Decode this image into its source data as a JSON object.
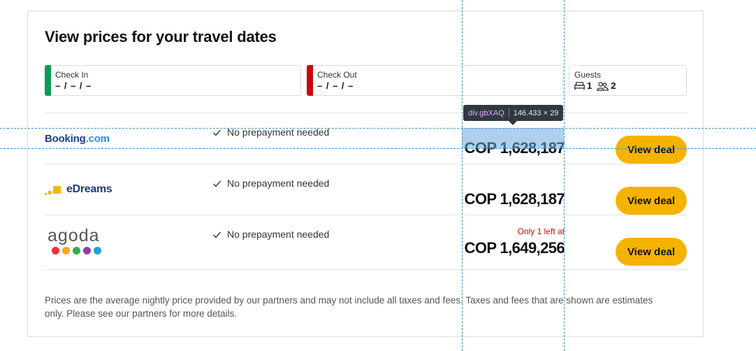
{
  "page": {
    "title": "View prices for your travel dates"
  },
  "dates": {
    "check_in": {
      "label": "Check In",
      "value": "– / – / –"
    },
    "check_out": {
      "label": "Check Out",
      "value": "– / – / –"
    },
    "guests": {
      "label": "Guests",
      "rooms": "1",
      "people": "2",
      "room_icon": "bed-icon",
      "people_icon": "people-icon"
    }
  },
  "offers": [
    {
      "provider": "Booking.com",
      "logo_main": "Booking",
      "logo_suffix": ".com",
      "feature": "No prepayment needed",
      "price": "COP 1,628,187",
      "scarcity": "",
      "button": "View deal"
    },
    {
      "provider": "eDreams",
      "logo_main": "eDreams",
      "feature": "No prepayment needed",
      "price": "COP 1,628,187",
      "scarcity": "",
      "button": "View deal"
    },
    {
      "provider": "agoda",
      "logo_main": "agoda",
      "feature": "No prepayment needed",
      "price": "COP 1,649,256",
      "scarcity": "Only 1 left at",
      "button": "View deal"
    }
  ],
  "footnote": "Prices are the average nightly price provided by our partners and may not include all taxes and fees. Taxes and fees that are shown are estimates only. Please see our partners for more details.",
  "inspector": {
    "selector": "div.gbXAQ",
    "dimensions": "146.433 × 29"
  },
  "colors": {
    "check_in_accent": "#0a9d58",
    "check_out_accent": "#c70808",
    "deal_button": "#f5b300",
    "booking_blue": "#1b3e88",
    "booking_light_blue": "#1c9ad6",
    "edreams_navy": "#1f3b80",
    "edreams_yellow": "#f5b700",
    "scarcity_red": "#c70808",
    "agoda_dots": [
      "#e8343d",
      "#f6a61c",
      "#2db34a",
      "#8e3fa2",
      "#17a5d8"
    ]
  }
}
